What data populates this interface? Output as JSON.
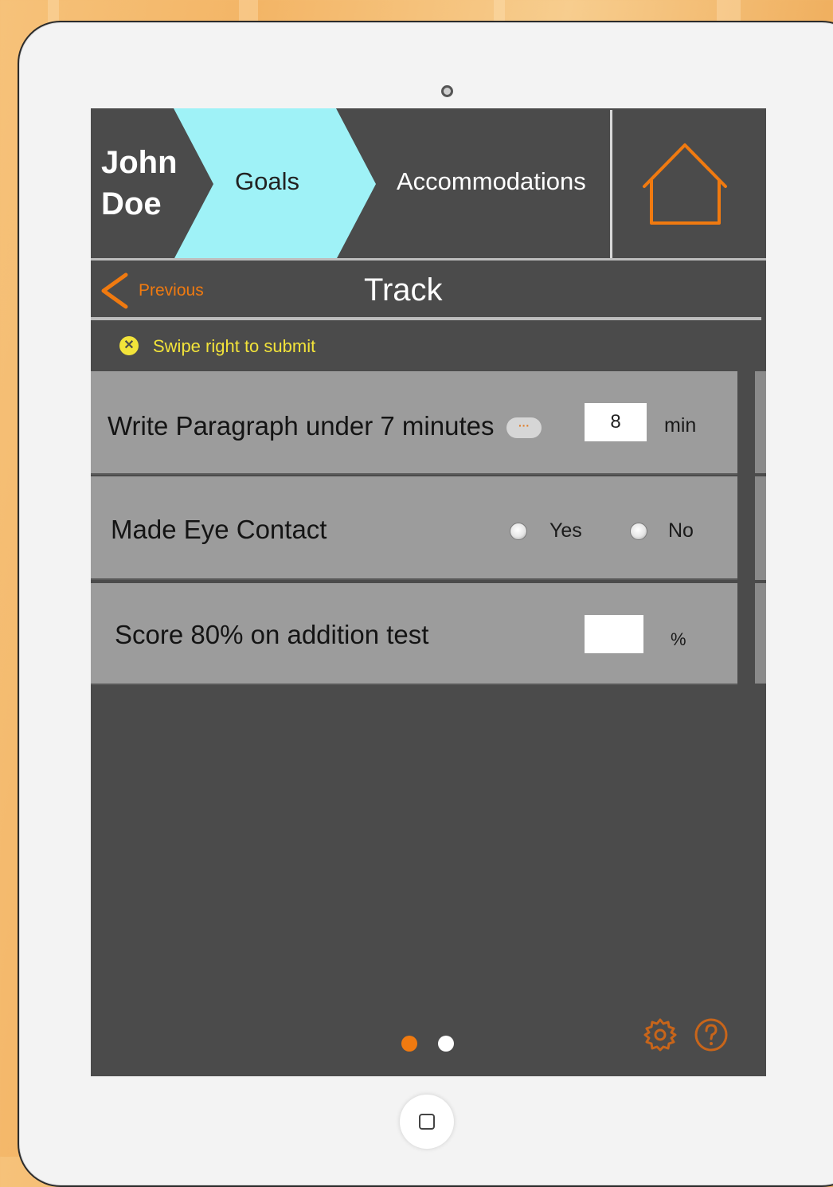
{
  "header": {
    "student_first": "John",
    "student_last": "Doe",
    "goals_tab": "Goals",
    "accommodations_tab": "Accommodations"
  },
  "toolbar": {
    "previous_label": "Previous",
    "title": "Track"
  },
  "notice": {
    "icon": "close-circle-icon",
    "text": "Swipe right to submit"
  },
  "goals": [
    {
      "label": "Write Paragraph under 7 minutes",
      "more_label": "···",
      "value": "8",
      "unit": "min"
    },
    {
      "label": "Made Eye Contact",
      "option_yes": "Yes",
      "option_no": "No"
    },
    {
      "label": "Score 80% on addition test",
      "value": "",
      "unit": "%"
    }
  ],
  "pager": {
    "pages": 2,
    "current": 1
  },
  "colors": {
    "accent": "#f07a10",
    "goals_tab": "#9ff2f7",
    "screen_bg": "#4b4b4b",
    "row_bg": "#9c9c9c",
    "notice": "#f2e33a"
  }
}
